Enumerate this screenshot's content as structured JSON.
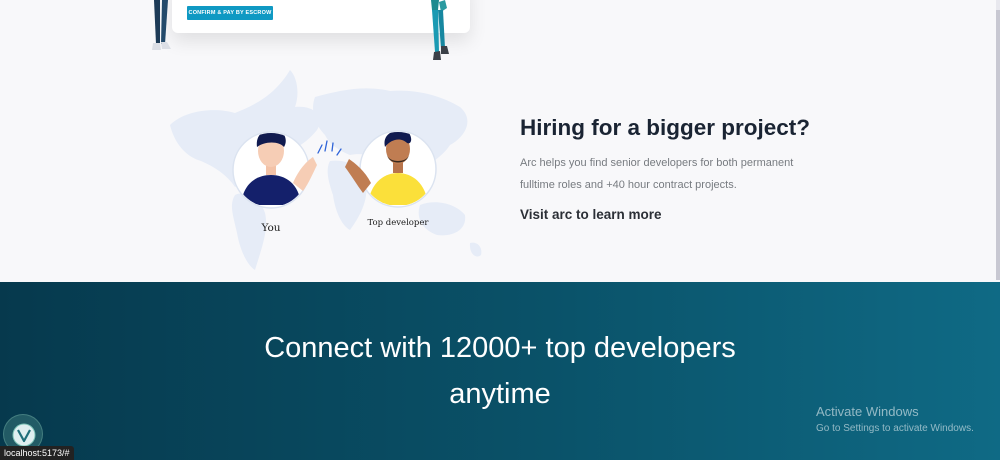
{
  "top_card": {
    "escrow_button": "CONFIRM & PAY BY ESCROW"
  },
  "illustration": {
    "you_label": "You",
    "developer_label": "Top developer"
  },
  "hiring": {
    "title": "Hiring for a bigger project?",
    "description": "Arc helps you find senior developers for both permanent fulltime roles and +40 hour contract projects.",
    "link_label": "Visit arc to learn more"
  },
  "cta": {
    "line1": "Connect with 12000+ top developers",
    "line2": "anytime"
  },
  "windows_watermark": {
    "title": "Activate Windows",
    "subtitle": "Go to Settings to activate Windows."
  },
  "status_bar": {
    "url": "localhost:5173/#"
  },
  "colors": {
    "band_start": "#06394d",
    "band_end": "#0f6a85",
    "button": "#0f99c3",
    "heading": "#1a2433"
  }
}
